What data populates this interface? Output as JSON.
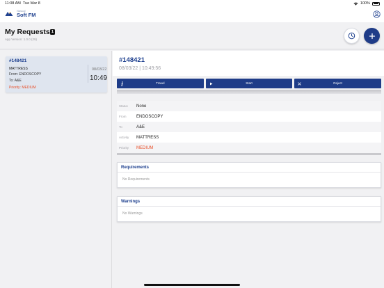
{
  "status_bar": {
    "time": "11:08 AM",
    "date": "Tue Mar 8",
    "battery": "100%",
    "icons": [
      "wifi-icon",
      "battery-icon"
    ]
  },
  "nav": {
    "logo_small": "Nasual",
    "logo_big": "Soft FM",
    "icons": [
      "app-logo-icon",
      "user-profile-icon"
    ]
  },
  "header": {
    "title": "My Requests",
    "count": "1",
    "version": "App Version: 1.0.0 (29)",
    "icons": [
      "history-clock-icon",
      "plus-icon"
    ]
  },
  "request_card": {
    "id": "#148421",
    "title": "MATTRESS",
    "from": "From: ENDOSCOPY",
    "to": "To: A&E",
    "priority": "Priority: MEDIUM",
    "date": "08/03/22",
    "time": "10:49"
  },
  "detail": {
    "id": "#148421",
    "datetime": "08/03/22 | 10:49:56",
    "actions": [
      {
        "label": "Travel",
        "icon": "walking-icon"
      },
      {
        "label": "Start",
        "icon": "play-icon"
      },
      {
        "label": "Reject",
        "icon": "close-icon"
      }
    ],
    "fields": [
      {
        "key": "Status",
        "value": "None"
      },
      {
        "key": "From",
        "value": "ENDOSCOPY"
      },
      {
        "key": "To",
        "value": "A&E"
      },
      {
        "key": "Activity",
        "value": "MATTRESS"
      },
      {
        "key": "Priority",
        "value": "MEDIUM"
      }
    ],
    "requirements": {
      "title": "Requirements",
      "empty": "No Requirements"
    },
    "warnings": {
      "title": "Warnings",
      "empty": "No Warnings"
    }
  },
  "colors": {
    "brand_blue": "#1f3c88",
    "id_blue": "#1d3f8e",
    "priority_orange": "#e8502a",
    "card_selected": "#dfe5ef"
  }
}
